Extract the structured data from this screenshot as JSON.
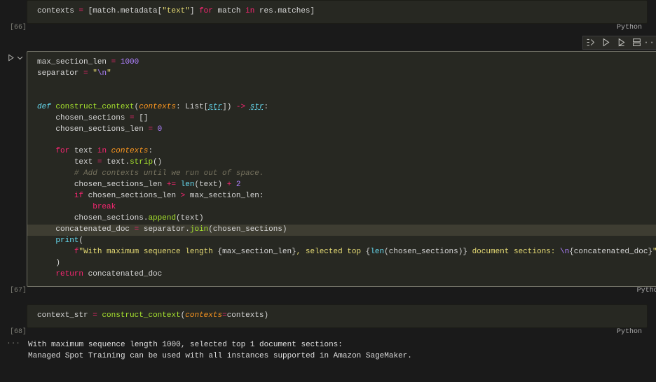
{
  "cells": {
    "cell66": {
      "id": "[66]",
      "lang": "Python",
      "code": {
        "var1": "contexts",
        "attr1": "match.metadata",
        "key": "\"text\"",
        "kw_for": "for",
        "kw_in": "in",
        "src": "res.matches"
      }
    },
    "cell67": {
      "id": "[67]",
      "lang": "Python",
      "toolbar": {
        "runByLine": "run-line",
        "execute": "execute",
        "executeBelow": "execute-below",
        "split": "split",
        "more": "more",
        "delete": "delete"
      },
      "code": {
        "l1_var": "max_section_len",
        "l1_eq": "=",
        "l1_val": "1000",
        "l2_var": "separator",
        "l2_eq": "=",
        "l2_q": "\"",
        "l2_esc": "\\n",
        "l2_q2": "\"",
        "l3_def": "def",
        "l3_name": "construct_context",
        "l3_p": "contexts",
        "l3_colon": ":",
        "l3_ann": "List",
        "l3_br1": "[",
        "l3_type": "str",
        "l3_br2": "]",
        "l3_arrow": "->",
        "l3_ret": "str",
        "l3_end": ":",
        "l4": "chosen_sections",
        "l4_eq": "=",
        "l4_val": "[]",
        "l5": "chosen_sections_len",
        "l5_eq": "=",
        "l5_val": "0",
        "l6_for": "for",
        "l6_var": "text",
        "l6_in": "in",
        "l6_it": "contexts",
        "l6_end": ":",
        "l7_lhs": "text",
        "l7_eq": "=",
        "l7_rhs": "text.",
        "l7_m": "strip",
        "l7_p": "()",
        "l8_cmt": "# Add contexts until we run out of space.",
        "l9_lhs": "chosen_sections_len",
        "l9_op": "+=",
        "l9_fn": "len",
        "l9_arg": "(text)",
        "l9_plus": "+",
        "l9_two": "2",
        "l10_if": "if",
        "l10_cond": "chosen_sections_len",
        "l10_gt": ">",
        "l10_rhs": "max_section_len",
        "l10_end": ":",
        "l11_break": "break",
        "l12_lhs": "chosen_sections.",
        "l12_m": "append",
        "l12_arg": "(text)",
        "l13_lhs": "concatenated_doc",
        "l13_eq": "=",
        "l13_rhs": "separator.",
        "l13_m": "join",
        "l13_arg": "(chosen_sections)",
        "l14_print": "print",
        "l14_open": "(",
        "l15_f": "f",
        "l15_q": "\"",
        "l15_t1": "With maximum sequence length ",
        "l15_b1": "{max_section_len}",
        "l15_t2": ", selected top ",
        "l15_b2": "{",
        "l15_len": "len",
        "l15_b2arg": "(chosen_sections)",
        "l15_b2close": "}",
        "l15_t3": " document sections: ",
        "l15_esc": "\\n",
        "l15_b3": "{concatenated_doc}",
        "l15_q2": "\"",
        "l16_close": ")",
        "l17_ret": "return",
        "l17_val": "concatenated_doc"
      }
    },
    "cell68": {
      "id": "[68]",
      "lang": "Python",
      "code": {
        "lhs": "context_str",
        "eq": "=",
        "fn": "construct_context",
        "p": "(",
        "kw": "contexts",
        "eq2": "=",
        "arg": "contexts",
        "close": ")"
      },
      "output": {
        "ellipsis": "...",
        "line1": "With maximum sequence length 1000, selected top 1 document sections: ",
        "line2": "Managed Spot Training can be used with all instances supported in Amazon SageMaker."
      }
    }
  }
}
